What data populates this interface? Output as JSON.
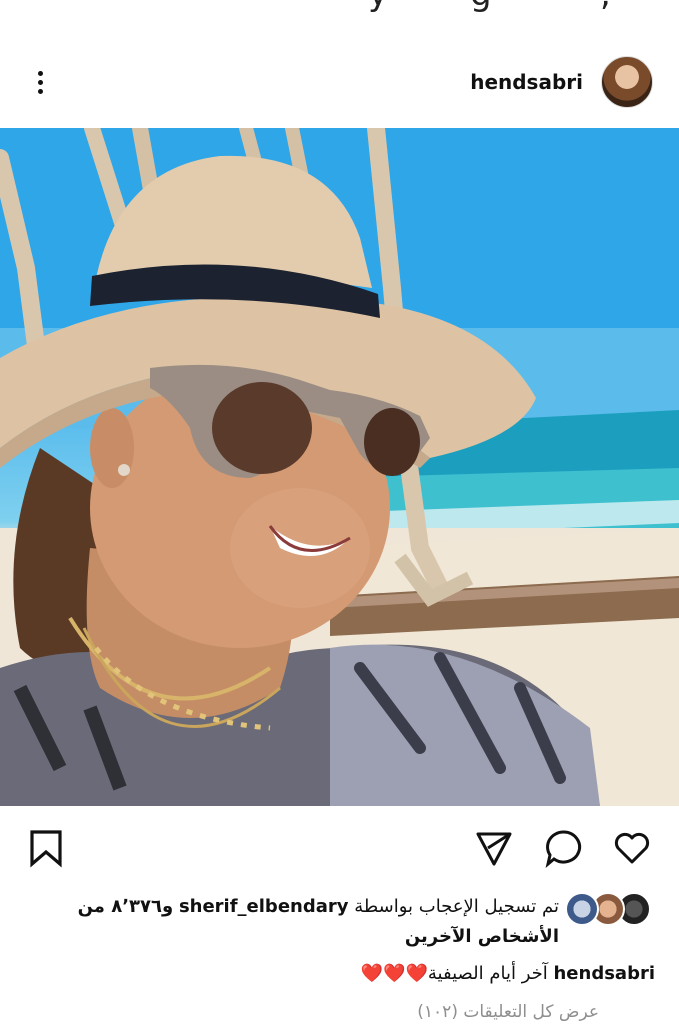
{
  "post": {
    "username": "hendsabri",
    "more_label": "⋮"
  },
  "likes": {
    "prefix": "تم تسجيل الإعجاب بواسطة",
    "liker": "sherif_elbendary",
    "suffix": "و٨٬٣٧٦ من الأشخاص الآخرين"
  },
  "caption": {
    "username": "hendsabri",
    "text": "آخر أيام الصيفية",
    "hearts": "❤️❤️❤️"
  },
  "comments": {
    "view_all": "عرض كل التعليقات (١٠٢)"
  },
  "icons": {
    "like": "heart-icon",
    "comment": "comment-icon",
    "share": "send-icon",
    "save": "bookmark-icon",
    "more": "more-vertical-icon"
  },
  "colors": {
    "heart_red": "#e0282e",
    "muted_text": "#8e8e8e"
  }
}
